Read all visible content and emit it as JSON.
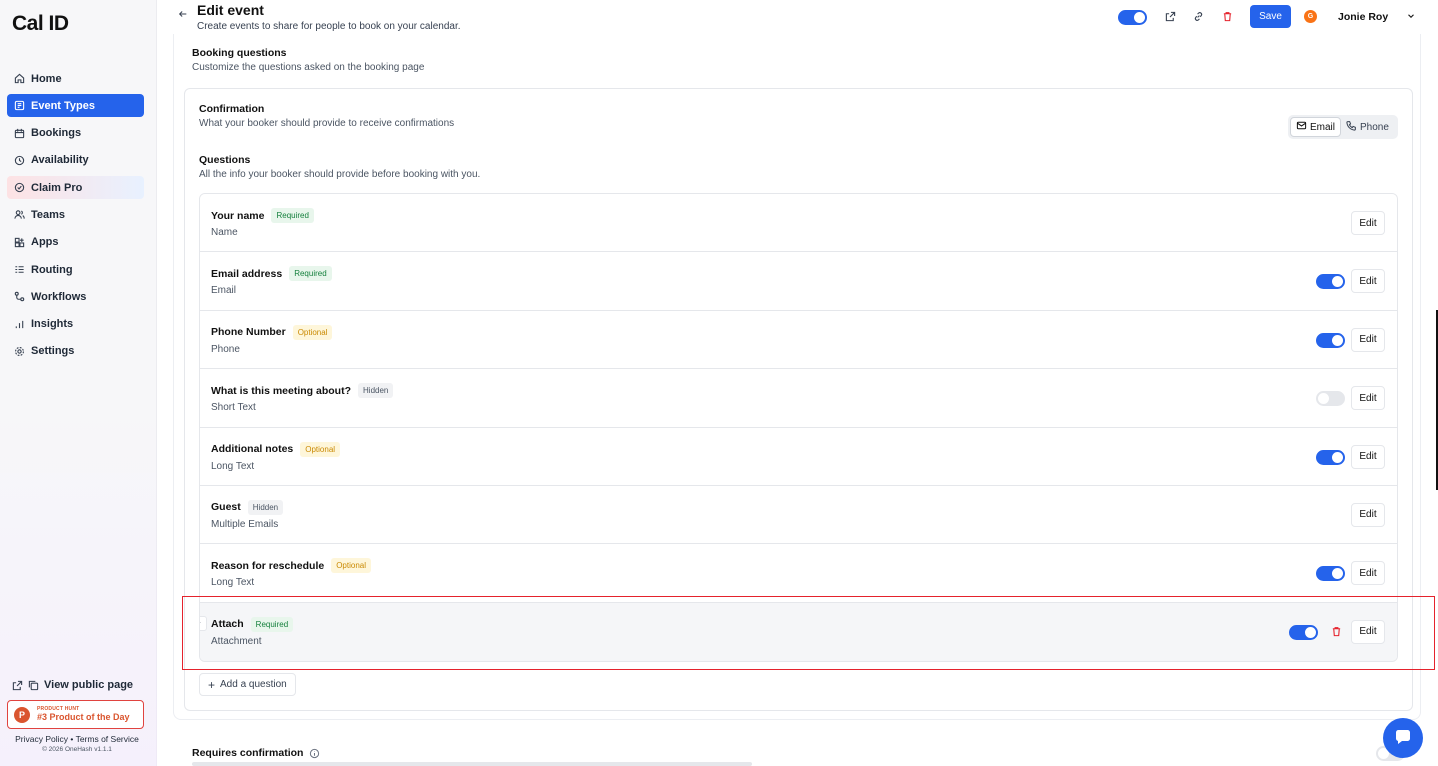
{
  "app": {
    "logo": "Cal ID"
  },
  "sidebar": {
    "items": [
      {
        "label": "Home",
        "icon": "home-icon"
      },
      {
        "label": "Event Types",
        "icon": "event-types-icon",
        "active": true
      },
      {
        "label": "Bookings",
        "icon": "calendar-icon"
      },
      {
        "label": "Availability",
        "icon": "clock-icon"
      },
      {
        "label": "Claim Pro",
        "icon": "badge-icon"
      },
      {
        "label": "Teams",
        "icon": "users-icon"
      },
      {
        "label": "Apps",
        "icon": "grid-icon"
      },
      {
        "label": "Routing",
        "icon": "routing-icon"
      },
      {
        "label": "Workflows",
        "icon": "workflow-icon"
      },
      {
        "label": "Insights",
        "icon": "bar-chart-icon"
      },
      {
        "label": "Settings",
        "icon": "gear-icon"
      }
    ],
    "view_public_page": "View public page",
    "product_hunt": {
      "small": "PRODUCT HUNT",
      "big": "#3 Product of the Day"
    },
    "legal": "Privacy Policy • Terms of Service",
    "copyright": "© 2026 OneHash v1.1.1"
  },
  "header": {
    "title": "Edit event",
    "subtitle": "Create events to share for people to book on your calendar.",
    "save_label": "Save",
    "user": {
      "initial": "G",
      "name": "Jonie Roy"
    },
    "hidden_toggle_on": true
  },
  "booking_questions": {
    "title": "Booking questions",
    "description": "Customize the questions asked on the booking page",
    "confirmation": {
      "title": "Confirmation",
      "description": "What your booker should provide to receive confirmations",
      "options": [
        "Email",
        "Phone"
      ],
      "selected": "Email"
    },
    "questions": {
      "title": "Questions",
      "description": "All the info your booker should provide before booking with you."
    },
    "rows": [
      {
        "label": "Your name",
        "badge": "Required",
        "badge_type": "required",
        "type": "Name",
        "toggle": null
      },
      {
        "label": "Email address",
        "badge": "Required",
        "badge_type": "required",
        "type": "Email",
        "toggle": true
      },
      {
        "label": "Phone Number",
        "badge": "Optional",
        "badge_type": "optional",
        "type": "Phone",
        "toggle": true
      },
      {
        "label": "What is this meeting about?",
        "badge": "Hidden",
        "badge_type": "hidden",
        "type": "Short Text",
        "toggle": false
      },
      {
        "label": "Additional notes",
        "badge": "Optional",
        "badge_type": "optional",
        "type": "Long Text",
        "toggle": true
      },
      {
        "label": "Guest",
        "badge": "Hidden",
        "badge_type": "hidden",
        "type": "Multiple Emails",
        "toggle": null
      },
      {
        "label": "Reason for reschedule",
        "badge": "Optional",
        "badge_type": "optional",
        "type": "Long Text",
        "toggle": true
      },
      {
        "label": "Attach",
        "badge": "Required",
        "badge_type": "required",
        "type": "Attachment",
        "toggle": true,
        "deletable": true,
        "highlight": true
      }
    ],
    "edit_label": "Edit",
    "add_question": "Add a question"
  },
  "requires_confirmation": {
    "title": "Requires confirmation"
  },
  "colors": {
    "accent": "#2563eb",
    "danger": "#e5222c",
    "required": "#15803d",
    "optional": "#ca8a04"
  }
}
